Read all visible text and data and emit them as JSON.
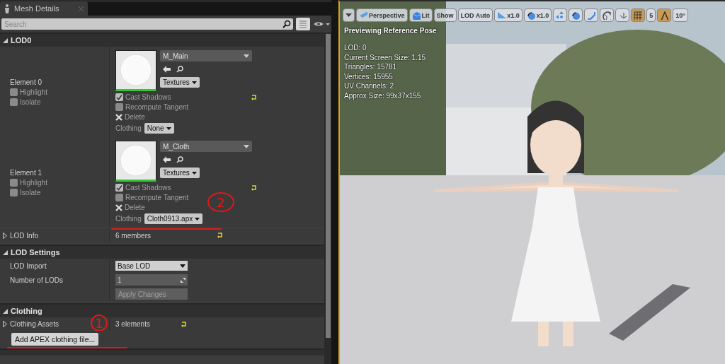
{
  "tab": {
    "title": "Mesh Details"
  },
  "search": {
    "placeholder": "Search"
  },
  "lod0": {
    "title": "LOD0",
    "expanded": true,
    "elements": [
      {
        "label": "Element 0",
        "highlight": false,
        "isolate": false,
        "highlight_label": "Highlight",
        "isolate_label": "Isolate",
        "material": "M_Main",
        "textures": "Textures",
        "cast_shadows": true,
        "cast_shadows_label": "Cast Shadows",
        "recompute_tangent": false,
        "recompute_label": "Recompute Tangent",
        "delete": "Delete",
        "clothing_label": "Clothing",
        "clothing": "None"
      },
      {
        "label": "Element 1",
        "highlight": false,
        "isolate": false,
        "highlight_label": "Highlight",
        "isolate_label": "Isolate",
        "material": "M_Cloth",
        "textures": "Textures",
        "cast_shadows": true,
        "cast_shadows_label": "Cast Shadows",
        "recompute_tangent": false,
        "recompute_label": "Recompute Tangent",
        "delete": "Delete",
        "clothing_label": "Clothing",
        "clothing": "Cloth0913.apx"
      }
    ],
    "info": {
      "label": "LOD Info",
      "value": "6 members",
      "expanded": false
    }
  },
  "lod_settings": {
    "title": "LOD Settings",
    "expanded": true,
    "rows": [
      {
        "kind": "combo",
        "label": "LOD Import",
        "value": "Base LOD"
      },
      {
        "kind": "spin",
        "label": "Number of LODs",
        "value": "1"
      },
      {
        "kind": "button",
        "value": "Apply Changes",
        "disabled": true
      }
    ]
  },
  "clothing": {
    "title": "Clothing",
    "expanded": true,
    "assets": {
      "label": "Clothing Assets",
      "value": "3 elements",
      "expanded": false
    },
    "button": "Add APEX clothing file..."
  },
  "annotations": [
    {
      "text": "2"
    },
    {
      "text": "1"
    }
  ],
  "viewport": {
    "toolbar": [
      {
        "selected": false
      },
      {
        "label": "Perspective",
        "selected": false
      },
      {
        "label": "Lit",
        "selected": false
      },
      {
        "label": "Show",
        "selected": false
      },
      {
        "label": "LOD Auto",
        "selected": false
      },
      {
        "label": "x1.0",
        "selected": false
      },
      {
        "label": "x1.0",
        "selected": false
      },
      {
        "selected": false
      },
      {
        "selected": false
      },
      {
        "selected": false
      },
      {
        "selected": false
      },
      {
        "selected": false
      },
      {
        "selected": true
      },
      {
        "label": "5",
        "selected": false
      },
      {
        "selected": true
      },
      {
        "label": "10°",
        "selected": false
      }
    ],
    "heading": "Previewing Reference Pose",
    "stats": [
      "LOD: 0",
      "Current Screen Size: 1.15",
      "Triangles: 15781",
      "Vertices: 15955",
      "UV Channels: 2",
      "Approx Size: 99x37x155"
    ]
  }
}
